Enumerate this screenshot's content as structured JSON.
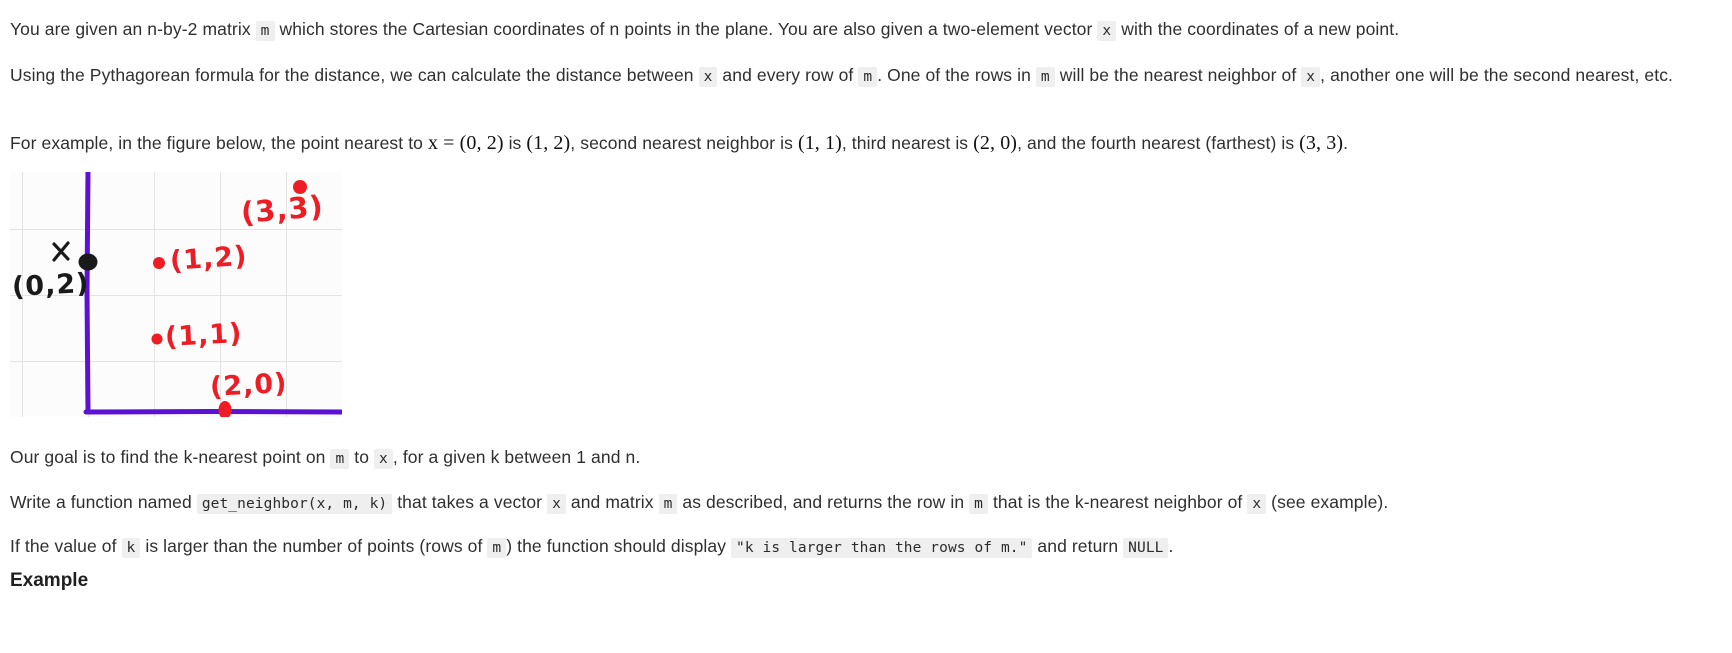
{
  "paragraphs": {
    "p1": {
      "t1": "You are given an n-by-2 matrix",
      "c1": "m",
      "t2": "which stores the Cartesian coordinates of n points in the plane. You are also given a two-element vector",
      "c2": "x",
      "t3": "with the coordinates of a new point."
    },
    "p2": {
      "t1": "Using the Pythagorean formula for the distance, we can calculate the distance between",
      "c1": "x",
      "t2": "and every row of",
      "c2": "m",
      "t3": ". One of the rows in",
      "c3": "m",
      "t4": "will be the nearest neighbor of",
      "c4": "x",
      "t5": ", another one will be the second nearest, etc."
    },
    "p3": {
      "t1": "For example, in the figure below, the point nearest to",
      "m1": "x = (0, 2)",
      "t2": "is",
      "m2": "(1, 2)",
      "t3": ", second nearest neighbor is",
      "m3": "(1, 1)",
      "t4": ", third nearest is",
      "m4": "(2, 0)",
      "t5": ", and the fourth nearest (farthest) is",
      "m5": "(3, 3)",
      "t6": "."
    },
    "p4": {
      "t1": "Our goal is to find the k-nearest point on",
      "c1": "m",
      "t2": "to",
      "c2": "x",
      "t3": ", for a given k between 1 and n."
    },
    "p5": {
      "t1": "Write a function named",
      "c1": "get_neighbor(x, m, k)",
      "t2": "that takes a vector",
      "c2": "x",
      "t3": "and matrix",
      "c3": "m",
      "t4": "as described, and returns the row in",
      "c4": "m",
      "t5": "that is the k-nearest neighbor of",
      "c5": "x",
      "t6": "(see example)."
    },
    "p6": {
      "t1": "If the value of",
      "c1": "k",
      "t2": "is larger than the number of points (rows of",
      "c2": "m",
      "t3": ") the function should display",
      "c3": "\"k is larger than the rows of m.\"",
      "t4": "and return",
      "c4": "NULL",
      "t5": "."
    }
  },
  "heading": "Example",
  "figure": {
    "axis_color": "#5b12d4",
    "point_color": "#ee1c24",
    "origin_point_color": "#1a1a1a",
    "labels": {
      "x_marker": "X",
      "origin": "(0,2)",
      "p12": "(1,2)",
      "p11": "(1,1)",
      "p20": "(2,0)",
      "p33": "(3,3)"
    },
    "points": [
      {
        "name": "x-point",
        "coord": "(0,2)",
        "color": "#1a1a1a"
      },
      {
        "name": "point-1-2",
        "coord": "(1,2)",
        "color": "#ee1c24"
      },
      {
        "name": "point-1-1",
        "coord": "(1,1)",
        "color": "#ee1c24"
      },
      {
        "name": "point-2-0",
        "coord": "(2,0)",
        "color": "#ee1c24"
      },
      {
        "name": "point-3-3",
        "coord": "(3,3)",
        "color": "#ee1c24"
      }
    ]
  }
}
